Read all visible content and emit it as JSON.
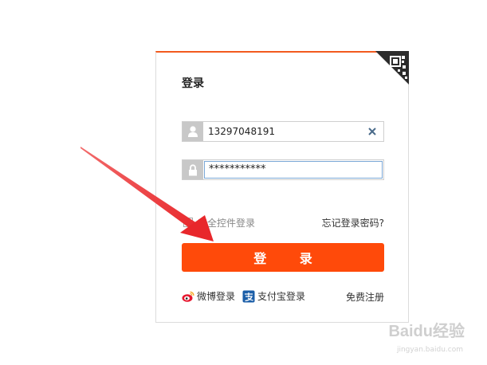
{
  "login": {
    "title": "登录",
    "username_value": "13297048191",
    "password_value": "***********",
    "safe_control_label": "安全控件登录",
    "forgot_password": "忘记登录密码?",
    "submit_label": "登 录",
    "weibo_label": "微博登录",
    "alipay_label": "支付宝登录",
    "register_label": "免费注册"
  },
  "watermark": {
    "brand": "Baidu经验",
    "url": "jingyan.baidu.com"
  },
  "colors": {
    "accent": "#ff4a0a",
    "top_border": "#f25a1e",
    "annotation_arrow": "#ee3b3b"
  },
  "icons": [
    "user-icon",
    "lock-icon",
    "clear-icon",
    "qr-code-icon",
    "weibo-icon",
    "alipay-icon",
    "checkbox-icon",
    "arrow-annotation"
  ]
}
